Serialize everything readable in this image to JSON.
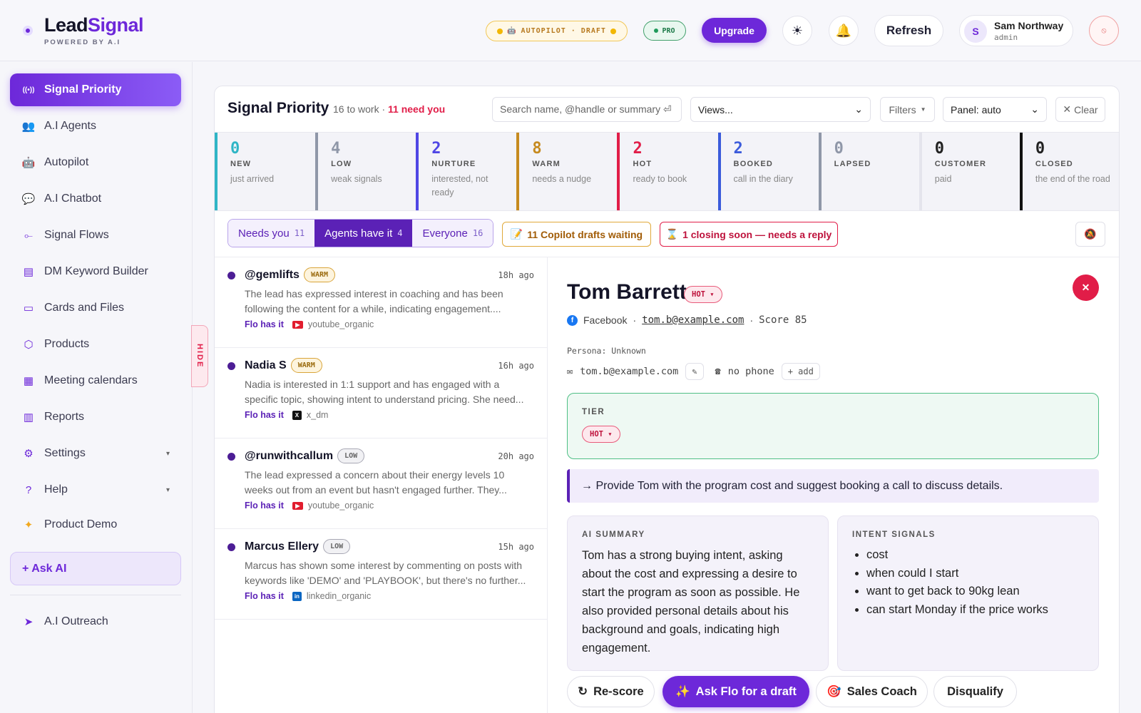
{
  "brand": {
    "name_a": "Lead",
    "name_b": "Signal",
    "tagline": "POWERED BY A.I"
  },
  "header": {
    "autopilot": "AUTOPILOT · DRAFT",
    "pro": "PRO",
    "upgrade": "Upgrade",
    "theme_icon": "☀",
    "bell_icon": "🔔",
    "refresh": "Refresh",
    "user_initial": "S",
    "user_name": "Sam Northway",
    "user_role": "admin",
    "stop_icon": "⦸"
  },
  "sidebar": {
    "items": [
      {
        "label": "Signal Priority",
        "icon": "((•))"
      },
      {
        "label": "A.I Agents",
        "icon": "👥"
      },
      {
        "label": "Autopilot",
        "icon": "🤖"
      },
      {
        "label": "A.I Chatbot",
        "icon": "💬"
      },
      {
        "label": "Signal Flows",
        "icon": "⟜"
      },
      {
        "label": "DM Keyword Builder",
        "icon": "▤"
      },
      {
        "label": "Cards and Files",
        "icon": "▭"
      },
      {
        "label": "Products",
        "icon": "⬡"
      },
      {
        "label": "Meeting calendars",
        "icon": "▦"
      },
      {
        "label": "Reports",
        "icon": "▥"
      },
      {
        "label": "Settings",
        "icon": "⚙",
        "caret": "▾"
      },
      {
        "label": "Help",
        "icon": "?",
        "caret": "▾"
      },
      {
        "label": "Product Demo",
        "icon": "✦"
      }
    ],
    "ask_ai": "+ Ask AI",
    "outreach": {
      "label": "A.I Outreach",
      "icon": "➤"
    },
    "hide_tab": "HIDE"
  },
  "main": {
    "title": "Signal Priority",
    "sub_count": "16 to work · ",
    "sub_need": "11 need you",
    "search_placeholder": "Search name, @handle or summary ⏎",
    "views": "Views...",
    "filters": "Filters",
    "panel": "Panel: auto",
    "clear": "Clear"
  },
  "stages": [
    {
      "count": "0",
      "label": "NEW",
      "desc": "just arrived",
      "color": "#2fb5c6"
    },
    {
      "count": "4",
      "label": "LOW",
      "desc": "weak signals",
      "color": "#8f97a8"
    },
    {
      "count": "2",
      "label": "NURTURE",
      "desc": "interested, not ready",
      "color": "#4f46e5"
    },
    {
      "count": "8",
      "label": "WARM",
      "desc": "needs a nudge",
      "color": "#c68a1f"
    },
    {
      "count": "2",
      "label": "HOT",
      "desc": "ready to book",
      "color": "#e11d48"
    },
    {
      "count": "2",
      "label": "BOOKED",
      "desc": "call in the diary",
      "color": "#3b5bdb"
    },
    {
      "count": "0",
      "label": "LAPSED",
      "desc": "",
      "color": "#8f97a8"
    },
    {
      "count": "0",
      "label": "CUSTOMER",
      "desc": "paid",
      "color": "#e4e4ec"
    },
    {
      "count": "0",
      "label": "CLOSED",
      "desc": "the end of the road",
      "color": "#111111"
    }
  ],
  "segments": [
    {
      "label": "Needs you",
      "count": "11"
    },
    {
      "label": "Agents have it",
      "count": "4"
    },
    {
      "label": "Everyone",
      "count": "16"
    }
  ],
  "alerts": {
    "drafts": "11 Copilot drafts waiting",
    "closing": "1 closing soon — needs a reply"
  },
  "leads": [
    {
      "name": "@gemlifts",
      "tier": "WARM",
      "ago": "18h ago",
      "summary": "The lead has expressed interest in coaching and has been following the content for a while, indicating engagement....",
      "owner": "Flo has it",
      "source": "youtube_organic"
    },
    {
      "name": "Nadia S",
      "tier": "WARM",
      "ago": "16h ago",
      "summary": "Nadia is interested in 1:1 support and has engaged with a specific topic, showing intent to understand pricing. She need...",
      "owner": "Flo has it",
      "source": "x_dm"
    },
    {
      "name": "@runwithcallum",
      "tier": "LOW",
      "ago": "20h ago",
      "summary": "The lead expressed a concern about their energy levels 10 weeks out from an event but hasn't engaged further. They...",
      "owner": "Flo has it",
      "source": "youtube_organic"
    },
    {
      "name": "Marcus Ellery",
      "tier": "LOW",
      "ago": "15h ago",
      "summary": "Marcus has shown some interest by commenting on posts with keywords like 'DEMO' and 'PLAYBOOK', but there's no further...",
      "owner": "Flo has it",
      "source": "linkedin_organic"
    }
  ],
  "detail": {
    "name": "Tom Barrett",
    "tier": "HOT ▾",
    "platform": "Facebook",
    "email": "tom.b@example.com",
    "score": "Score 85",
    "persona": "Persona: Unknown",
    "contact_email": "tom.b@example.com",
    "phone": "no phone",
    "add": "+ add",
    "tier_label": "TIER",
    "tier_value": "HOT ▾",
    "next_action": "→ Provide Tom with the program cost and suggest booking a call to discuss details.",
    "summary_label": "AI SUMMARY",
    "summary": "Tom has a strong buying intent, asking about the cost and expressing a desire to start the program as soon as possible. He also provided personal details about his background and goals, indicating high engagement.",
    "intent_label": "INTENT SIGNALS",
    "intents": [
      "cost",
      "when could I start",
      "want to get back to 90kg lean",
      "can start Monday if the price works"
    ],
    "actions": {
      "rescore": "Re-score",
      "askflo": "Ask Flo for a draft",
      "coach": "Sales Coach",
      "disqualify": "Disqualify"
    }
  }
}
